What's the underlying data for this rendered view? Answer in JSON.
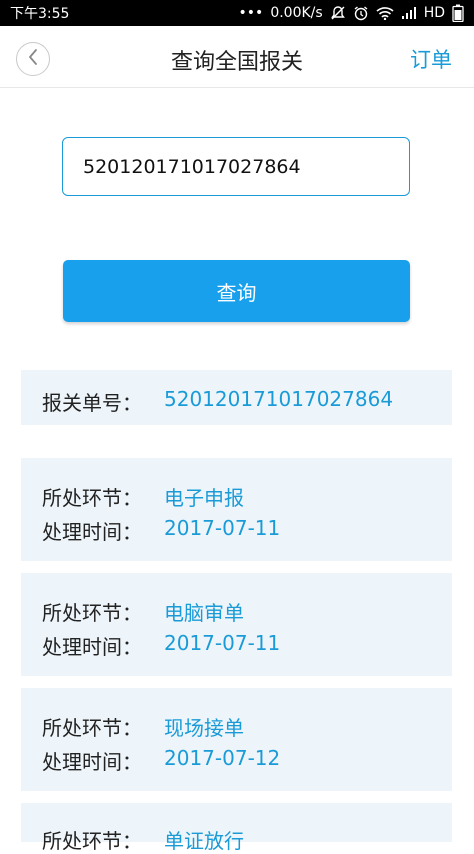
{
  "status_bar": {
    "time": "下午3:55",
    "dots": "•••",
    "network_speed": "0.00K/s",
    "network_type": "HD"
  },
  "nav": {
    "title": "查询全国报关",
    "right_label": "订单"
  },
  "search": {
    "value": "520120171017027864"
  },
  "query_button": {
    "label": "查询"
  },
  "declaration": {
    "label": "报关单号：",
    "number": "520120171017027864"
  },
  "records": [
    {
      "stage_label": "所处环节：",
      "stage": "电子申报",
      "time_label": "处理时间：",
      "time": "2017-07-11"
    },
    {
      "stage_label": "所处环节：",
      "stage": "电脑审单",
      "time_label": "处理时间：",
      "time": "2017-07-11"
    },
    {
      "stage_label": "所处环节：",
      "stage": "现场接单",
      "time_label": "处理时间：",
      "time": "2017-07-12"
    },
    {
      "stage_label": "所处环节：",
      "stage": "单证放行"
    }
  ],
  "colors": {
    "accent": "#1a9bd7",
    "button": "#19a0ec",
    "card_bg": "#eef5fa"
  },
  "icons": [
    "back-chevron-icon",
    "silent-icon",
    "alarm-icon",
    "wifi-icon",
    "signal-icon",
    "battery-icon"
  ]
}
